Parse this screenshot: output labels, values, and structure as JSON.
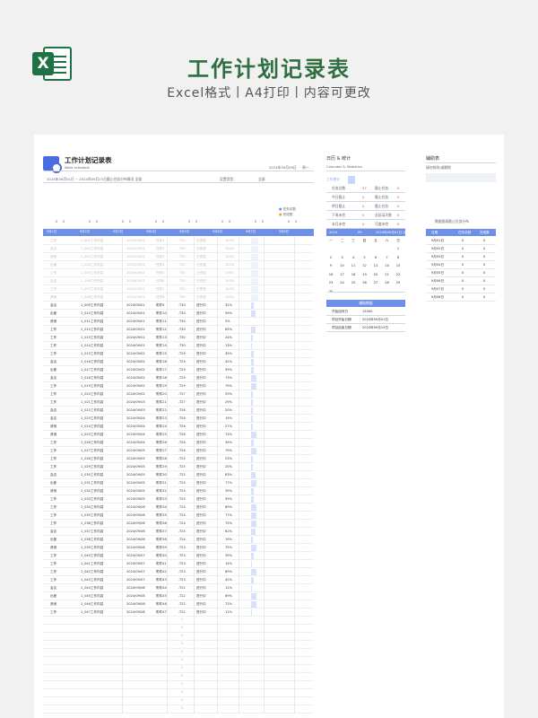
{
  "hero": {
    "title": "工作计划记录表",
    "subtitle": "Excel格式丨A4打印丨内容可更改",
    "excel_letter": "X"
  },
  "sheet": {
    "title": "工作计划记录表",
    "subtitle_en": "Work schedule",
    "date": "2024年09月09日",
    "week_label": "周一",
    "filter_text": "2024年09月01日 ~ 2024年09月15日截止任务分布情况  全部",
    "setting_label": "设置类型：",
    "setting_value": "全部",
    "legend": [
      "任务总数",
      "完成数"
    ],
    "day_headers": [
      "9月1日",
      "9月2日",
      "9月3日",
      "9月4日",
      "9月5日",
      "9月6日",
      "9月7日",
      "9月8日"
    ],
    "ghost_rows": [
      [
        "工作",
        "1_001工作内容",
        "2024/09/01",
        "任务1",
        "-T30",
        "已完成",
        "100%"
      ],
      [
        "会议",
        "1_002工作内容",
        "2024/09/01",
        "任务2",
        "-T30",
        "已完成",
        "100%"
      ],
      [
        "其他",
        "1_003工作内容",
        "2024/09/01",
        "任务3",
        "-T30",
        "已完成",
        "100%"
      ],
      [
        "出差",
        "1_004工作内容",
        "2024/09/01",
        "任务4",
        "-T30",
        "已完成",
        "100%"
      ],
      [
        "工作",
        "1_005工作内容",
        "2024/09/01",
        "任务5",
        "-T30",
        "已完成",
        "100%"
      ],
      [
        "会议",
        "1_006工作内容",
        "2024/09/01",
        "任务6",
        "-T30",
        "已完成",
        "100%"
      ],
      [
        "工作",
        "1_007工作内容",
        "2024/09/01",
        "任务7",
        "-T30",
        "已完成",
        "100%"
      ],
      [
        "其他",
        "1_008工作内容",
        "2024/09/01",
        "任务8",
        "-T30",
        "已完成",
        "100%"
      ]
    ],
    "rows": [
      [
        "会议",
        "1_009工作内容",
        "2024/09/01",
        "附件9",
        "-T30",
        "进行中",
        "32%"
      ],
      [
        "出差",
        "1_010工作内容",
        "2024/09/01",
        "附件10",
        "-T30",
        "进行中",
        "59%"
      ],
      [
        "其他",
        "1_011工作内容",
        "2024/09/01",
        "附件11",
        "-T30",
        "进行中",
        "5%"
      ],
      [
        "工作",
        "1_012工作内容",
        "2024/09/01",
        "附件12",
        "-T30",
        "进行中",
        "65%"
      ],
      [
        "工作",
        "1_013工作内容",
        "2024/09/01",
        "附件13",
        "-T30",
        "进行中",
        "24%"
      ],
      [
        "工作",
        "1_014工作内容",
        "2024/09/01",
        "附件14",
        "-T30",
        "进行中",
        "13%"
      ],
      [
        "工作",
        "1_015工作内容",
        "2024/09/02",
        "附件15",
        "-T29",
        "进行中",
        "35%"
      ],
      [
        "会议",
        "1_016工作内容",
        "2024/09/02",
        "附件16",
        "-T29",
        "进行中",
        "42%"
      ],
      [
        "出差",
        "1_017工作内容",
        "2024/09/02",
        "附件17",
        "-T29",
        "进行中",
        "39%"
      ],
      [
        "会议",
        "1_018工作内容",
        "2024/09/02",
        "附件18",
        "-T29",
        "进行中",
        "73%"
      ],
      [
        "工作",
        "1_019工作内容",
        "2024/09/02",
        "附件19",
        "-T29",
        "进行中",
        "79%"
      ],
      [
        "工作",
        "1_020工作内容",
        "2024/09/02",
        "附件20",
        "-T27",
        "进行中",
        "29%"
      ],
      [
        "工作",
        "1_021工作内容",
        "2024/09/03",
        "附件21",
        "-T27",
        "进行中",
        "29%"
      ],
      [
        "会议",
        "1_022工作内容",
        "2024/09/03",
        "附件22",
        "-T26",
        "进行中",
        "20%"
      ],
      [
        "会议",
        "1_023工作内容",
        "2024/09/04",
        "附件23",
        "-T26",
        "进行中",
        "19%"
      ],
      [
        "其他",
        "1_024工作内容",
        "2024/09/04",
        "附件24",
        "-T26",
        "进行中",
        "27%"
      ],
      [
        "其他",
        "1_025工作内容",
        "2024/09/04",
        "附件25",
        "-T26",
        "进行中",
        "73%"
      ],
      [
        "工作",
        "1_026工作内容",
        "2024/09/04",
        "附件26",
        "-T26",
        "进行中",
        "39%"
      ],
      [
        "工作",
        "1_027工作内容",
        "2024/09/05",
        "附件27",
        "-T26",
        "进行中",
        "79%"
      ],
      [
        "工作",
        "1_028工作内容",
        "2024/09/05",
        "附件28",
        "-T25",
        "进行中",
        "23%"
      ],
      [
        "工作",
        "1_029工作内容",
        "2024/09/05",
        "附件29",
        "-T25",
        "进行中",
        "25%"
      ],
      [
        "会议",
        "1_030工作内容",
        "2024/09/05",
        "附件30",
        "-T25",
        "进行中",
        "63%"
      ],
      [
        "出差",
        "1_031工作内容",
        "2024/09/05",
        "附件31",
        "-T25",
        "进行中",
        "77%"
      ],
      [
        "其他",
        "1_032工作内容",
        "2024/09/05",
        "附件32",
        "-T25",
        "进行中",
        "39%"
      ],
      [
        "工作",
        "1_033工作内容",
        "2024/09/05",
        "附件33",
        "-T25",
        "进行中",
        "39%"
      ],
      [
        "工作",
        "1_034工作内容",
        "2024/09/06",
        "附件34",
        "-T24",
        "进行中",
        "69%"
      ],
      [
        "工作",
        "1_035工作内容",
        "2024/09/06",
        "附件35",
        "-T24",
        "进行中",
        "77%"
      ],
      [
        "工作",
        "1_036工作内容",
        "2024/09/06",
        "附件36",
        "-T24",
        "进行中",
        "75%"
      ],
      [
        "会议",
        "1_037工作内容",
        "2024/09/06",
        "附件37",
        "-T24",
        "进行中",
        "62%"
      ],
      [
        "出差",
        "1_038工作内容",
        "2024/09/06",
        "附件38",
        "-T24",
        "进行中",
        "19%"
      ],
      [
        "其他",
        "1_039工作内容",
        "2024/09/06",
        "附件39",
        "-T23",
        "进行中",
        "75%"
      ],
      [
        "工作",
        "1_040工作内容",
        "2024/09/07",
        "附件40",
        "-T23",
        "进行中",
        "39%"
      ],
      [
        "工作",
        "1_041工作内容",
        "2024/09/07",
        "附件41",
        "-T23",
        "进行中",
        "15%"
      ],
      [
        "工作",
        "1_042工作内容",
        "2024/09/07",
        "附件42",
        "-T23",
        "进行中",
        "69%"
      ],
      [
        "工作",
        "1_043工作内容",
        "2024/09/07",
        "附件43",
        "-T23",
        "进行中",
        "42%"
      ],
      [
        "会议",
        "1_044工作内容",
        "2024/09/08",
        "附件44",
        "-T22",
        "进行中",
        "12%"
      ],
      [
        "出差",
        "1_045工作内容",
        "2024/09/08",
        "附件45",
        "-T22",
        "进行中",
        "69%"
      ],
      [
        "其他",
        "1_046工作内容",
        "2024/09/08",
        "附件46",
        "-T22",
        "进行中",
        "72%"
      ],
      [
        "工作",
        "1_047工作内容",
        "2024/09/08",
        "附件47",
        "-T22",
        "进行中",
        "11%"
      ]
    ],
    "empty_cell_mark": "0"
  },
  "calendar": {
    "title": "日历 & 统计",
    "title_en": "Calendar & Statistics",
    "section": "工作统计",
    "stats": [
      [
        "任务总数",
        "37",
        "截止任务",
        "0"
      ],
      [
        "今日截止",
        "0",
        "截止任务",
        "0"
      ],
      [
        "明日截止",
        "0",
        "截止任务",
        "0"
      ],
      [
        "下周未完",
        "0",
        "总延误天数",
        "0"
      ],
      [
        "本月未完",
        "0",
        "月度未完",
        "0"
      ]
    ],
    "year": "2024",
    "month": "09",
    "range": "2024年09月01日 (周)",
    "weekdays": [
      "一",
      "二",
      "三",
      "四",
      "五",
      "六",
      "日"
    ],
    "days": [
      [
        "",
        "",
        "",
        "",
        "",
        "",
        "1"
      ],
      [
        "2",
        "3",
        "4",
        "5",
        "6",
        "7",
        "8"
      ],
      [
        "9",
        "10",
        "11",
        "12",
        "13",
        "14",
        "15"
      ],
      [
        "16",
        "17",
        "18",
        "19",
        "20",
        "21",
        "22"
      ],
      [
        "23",
        "24",
        "25",
        "26",
        "27",
        "28",
        "29"
      ],
      [
        "30",
        "",
        "",
        "",
        "",
        "",
        ""
      ]
    ]
  },
  "assist_data": {
    "header": "辅助数据",
    "rows": [
      [
        "开始如何日",
        "15000"
      ],
      [
        "项目开始日期",
        "2024年09月01日"
      ],
      [
        "项目结束日期",
        "2024年09月15日"
      ]
    ]
  },
  "right": {
    "title": "辅助表",
    "note": "请勿修改/或删除",
    "table_title": "数据图表截止任务分布",
    "headers": [
      "日期",
      "任务总数",
      "完成数"
    ],
    "rows": [
      [
        "9月01日",
        "0",
        "0"
      ],
      [
        "9月02日",
        "0",
        "0"
      ],
      [
        "9月03日",
        "0",
        "0"
      ],
      [
        "9月04日",
        "0",
        "0"
      ],
      [
        "9月05日",
        "0",
        "0"
      ],
      [
        "9月06日",
        "0",
        "0"
      ],
      [
        "9月07日",
        "0",
        "0"
      ],
      [
        "9月08日",
        "0",
        "0"
      ]
    ]
  },
  "colors": {
    "excel_green": "#1f7244",
    "title_green": "#2f6f40",
    "header_blue": "#6d8fe8",
    "progress_fill": "#d6e2fb"
  }
}
